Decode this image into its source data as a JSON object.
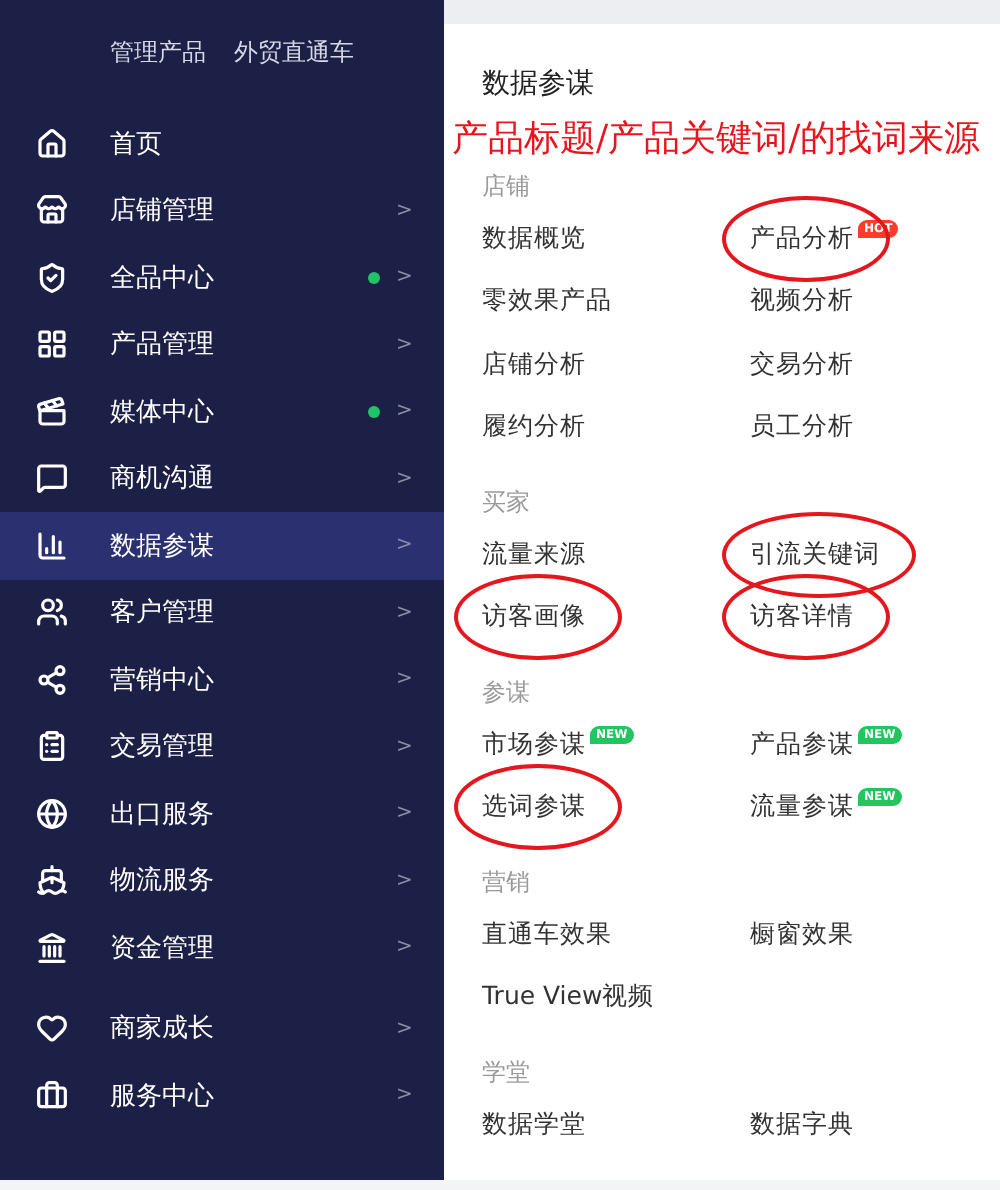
{
  "top_links": [
    {
      "label": "管理产品"
    },
    {
      "label": "外贸直通车"
    }
  ],
  "sidebar": {
    "groups": [
      {
        "items": [
          {
            "label": "首页",
            "dot": false,
            "arrow": false,
            "selected": false
          },
          {
            "label": "店铺管理",
            "dot": false,
            "arrow": true,
            "selected": false
          },
          {
            "label": "全品中心",
            "dot": true,
            "arrow": true,
            "selected": false
          },
          {
            "label": "产品管理",
            "dot": false,
            "arrow": true,
            "selected": false
          },
          {
            "label": "媒体中心",
            "dot": true,
            "arrow": true,
            "selected": false
          },
          {
            "label": "商机沟通",
            "dot": false,
            "arrow": true,
            "selected": false
          },
          {
            "label": "数据参谋",
            "dot": false,
            "arrow": true,
            "selected": true
          },
          {
            "label": "客户管理",
            "dot": false,
            "arrow": true,
            "selected": false
          },
          {
            "label": "营销中心",
            "dot": false,
            "arrow": true,
            "selected": false
          },
          {
            "label": "交易管理",
            "dot": false,
            "arrow": true,
            "selected": false
          },
          {
            "label": "出口服务",
            "dot": false,
            "arrow": true,
            "selected": false
          },
          {
            "label": "物流服务",
            "dot": false,
            "arrow": true,
            "selected": false
          },
          {
            "label": "资金管理",
            "dot": false,
            "arrow": true,
            "selected": false
          }
        ]
      },
      {
        "items": [
          {
            "label": "商家成长",
            "dot": false,
            "arrow": true,
            "selected": false
          },
          {
            "label": "服务中心",
            "dot": false,
            "arrow": true,
            "selected": false
          }
        ]
      }
    ],
    "arrow_char": ">"
  },
  "panel": {
    "title": "数据参谋",
    "sections": [
      {
        "heading": "店铺",
        "items": [
          {
            "label": "数据概览",
            "circled": false
          },
          {
            "label": "产品分析",
            "badge": {
              "text": "HOT",
              "color": "#ff3b30"
            },
            "circled": true
          },
          {
            "label": "零效果产品",
            "circled": false
          },
          {
            "label": "视频分析",
            "circled": false
          },
          {
            "label": "店铺分析",
            "circled": false
          },
          {
            "label": "交易分析",
            "circled": false
          },
          {
            "label": "履约分析",
            "circled": false
          },
          {
            "label": "员工分析",
            "circled": false
          }
        ]
      },
      {
        "heading": "买家",
        "items": [
          {
            "label": "流量来源",
            "circled": false
          },
          {
            "label": "引流关键词",
            "circled": true
          },
          {
            "label": "访客画像",
            "circled": true
          },
          {
            "label": "访客详情",
            "circled": true
          }
        ]
      },
      {
        "heading": "参谋",
        "items": [
          {
            "label": "市场参谋",
            "badge": {
              "text": "NEW",
              "color": "#22c55e"
            },
            "circled": false
          },
          {
            "label": "产品参谋",
            "badge": {
              "text": "NEW",
              "color": "#22c55e"
            },
            "circled": false
          },
          {
            "label": "选词参谋",
            "circled": true
          },
          {
            "label": "流量参谋",
            "badge": {
              "text": "NEW",
              "color": "#22c55e"
            },
            "circled": false
          }
        ]
      },
      {
        "heading": "营销",
        "items": [
          {
            "label": "直通车效果",
            "circled": false
          },
          {
            "label": "橱窗效果",
            "circled": false
          },
          {
            "label": "True View视频",
            "circled": false
          }
        ]
      },
      {
        "heading": "学堂",
        "items": [
          {
            "label": "数据学堂",
            "circled": false
          },
          {
            "label": "数据字典",
            "circled": false
          }
        ]
      }
    ]
  },
  "annotation": {
    "text": "产品标题/产品关键词/的找词来源"
  }
}
